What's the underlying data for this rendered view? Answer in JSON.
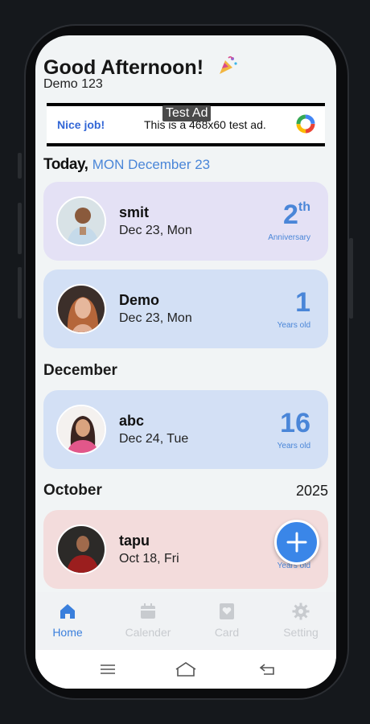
{
  "header": {
    "greeting": "Good Afternoon!",
    "user": "Demo 123"
  },
  "ad": {
    "tag": "Test Ad",
    "left_text": "Nice job!",
    "middle_text": "This is a 468x60 test ad."
  },
  "today": {
    "label": "Today,",
    "date": "MON December 23"
  },
  "today_cards": [
    {
      "name": "smit",
      "date": "Dec 23, Mon",
      "number": "2",
      "suffix": "th",
      "caption": "Anniversary"
    },
    {
      "name": "Demo",
      "date": "Dec 23, Mon",
      "number": "1",
      "suffix": "",
      "caption": "Years old"
    }
  ],
  "december": {
    "title": "December",
    "cards": [
      {
        "name": "abc",
        "date": "Dec 24, Tue",
        "number": "16",
        "caption": "Years old"
      }
    ]
  },
  "october": {
    "title": "October",
    "year": "2025",
    "cards": [
      {
        "name": "tapu",
        "date": "Oct 18, Fri",
        "caption": "Years old"
      }
    ]
  },
  "nav": {
    "home": "Home",
    "calender": "Calender",
    "card": "Card",
    "setting": "Setting"
  },
  "colors": {
    "accent": "#3a86e8",
    "card_purple": "#e4e1f5",
    "card_blue": "#d3e0f5",
    "card_pink": "#f3dcdc"
  }
}
